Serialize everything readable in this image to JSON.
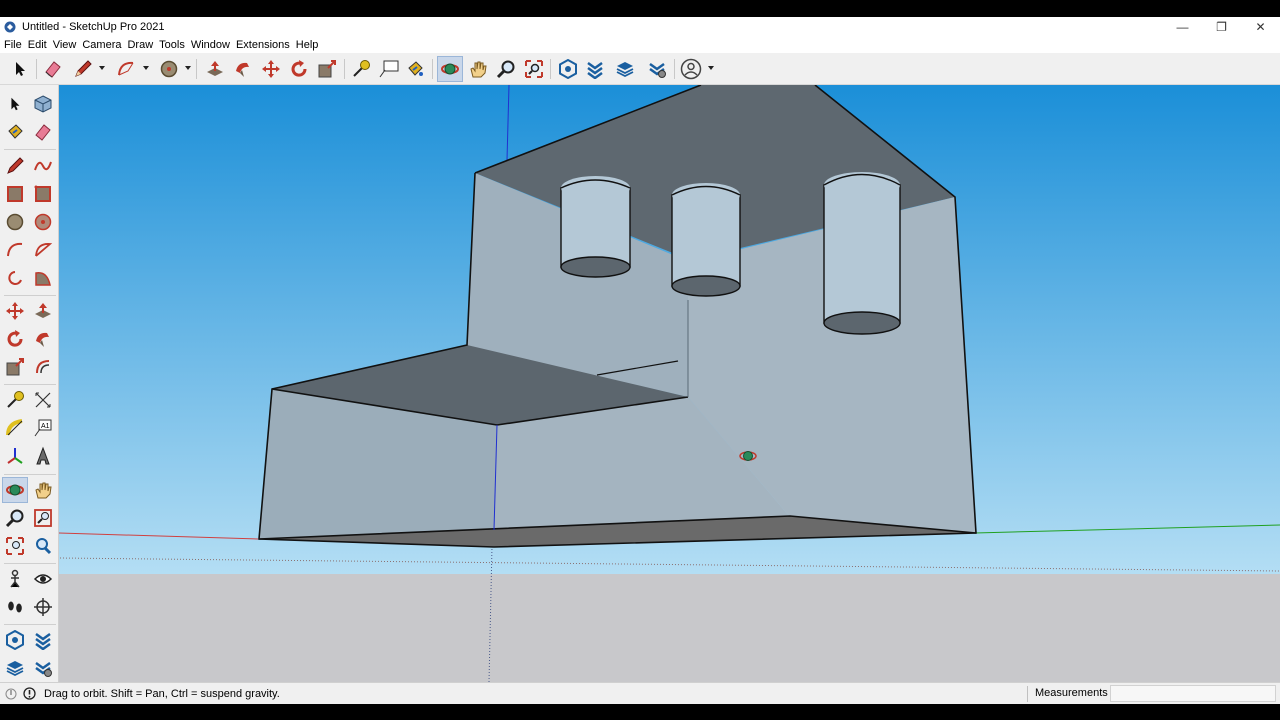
{
  "window": {
    "title": "Untitled - SketchUp Pro 2021",
    "minimize_glyph": "—",
    "restore_glyph": "❐",
    "close_glyph": "✕"
  },
  "menu": [
    "File",
    "Edit",
    "View",
    "Camera",
    "Draw",
    "Tools",
    "Window",
    "Extensions",
    "Help"
  ],
  "toolbar": {
    "active_tool": "orbit",
    "text_tool_glyph": "A1"
  },
  "left_toolbar": {
    "active_tool": "orbit",
    "text_tool_glyph": "A1"
  },
  "statusbar": {
    "hint": "Drag to orbit. Shift = Pan, Ctrl = suspend gravity.",
    "measurements_label": "Measurements",
    "measurements_value": ""
  },
  "colors": {
    "sky_top": "#1b8fd8",
    "sky_bottom": "#b4def4",
    "ground": "#c8c8cb",
    "face_front": "#a3b3bf",
    "face_top": "#5e6870",
    "axis_red": "#d04040",
    "axis_green": "#20a020",
    "axis_blue": "#2030d0"
  }
}
